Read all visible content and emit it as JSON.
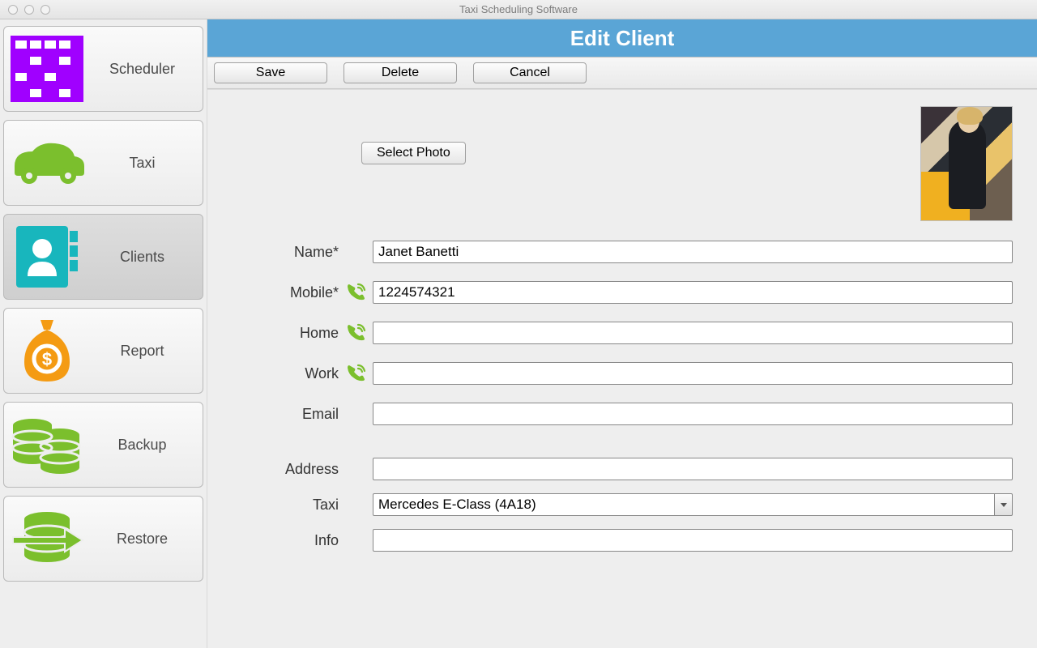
{
  "window_title": "Taxi Scheduling Software",
  "sidebar": {
    "items": [
      {
        "label": "Scheduler"
      },
      {
        "label": "Taxi"
      },
      {
        "label": "Clients"
      },
      {
        "label": "Report"
      },
      {
        "label": "Backup"
      },
      {
        "label": "Restore"
      }
    ]
  },
  "header": {
    "title": "Edit Client"
  },
  "toolbar": {
    "save": "Save",
    "delete": "Delete",
    "cancel": "Cancel"
  },
  "photo": {
    "select_label": "Select Photo"
  },
  "form": {
    "name_label": "Name*",
    "name_value": "Janet Banetti",
    "mobile_label": "Mobile*",
    "mobile_value": "1224574321",
    "home_label": "Home",
    "home_value": "",
    "work_label": "Work",
    "work_value": "",
    "email_label": "Email",
    "email_value": "",
    "address_label": "Address",
    "address_value": "",
    "taxi_label": "Taxi",
    "taxi_value": "Mercedes E-Class (4A18)",
    "info_label": "Info",
    "info_value": ""
  }
}
